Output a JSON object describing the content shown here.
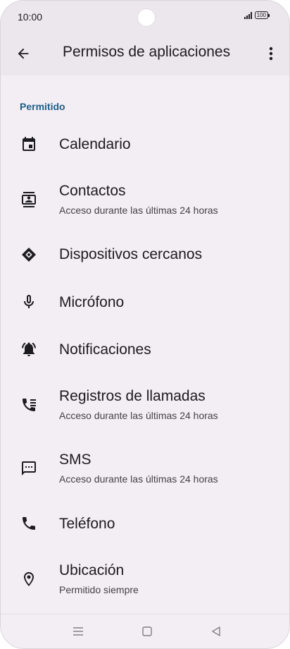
{
  "status_bar": {
    "time": "10:00",
    "battery": "100"
  },
  "app_bar": {
    "title": "Permisos de aplicaciones"
  },
  "section": {
    "label": "Permitido"
  },
  "items": [
    {
      "label": "Calendario",
      "icon": "calendar-icon"
    },
    {
      "label": "Contactos",
      "sub": "Acceso durante las últimas 24 horas",
      "icon": "contacts-icon"
    },
    {
      "label": "Dispositivos cercanos",
      "icon": "nearby-devices-icon"
    },
    {
      "label": "Micrófono",
      "icon": "microphone-icon"
    },
    {
      "label": "Notificaciones",
      "icon": "bell-icon"
    },
    {
      "label": "Registros de llamadas",
      "sub": "Acceso durante las últimas 24 horas",
      "icon": "call-log-icon"
    },
    {
      "label": "SMS",
      "sub": "Acceso durante las últimas 24 horas",
      "icon": "sms-icon"
    },
    {
      "label": "Teléfono",
      "icon": "phone-icon"
    },
    {
      "label": "Ubicación",
      "sub": "Permitido siempre",
      "icon": "location-icon"
    }
  ]
}
